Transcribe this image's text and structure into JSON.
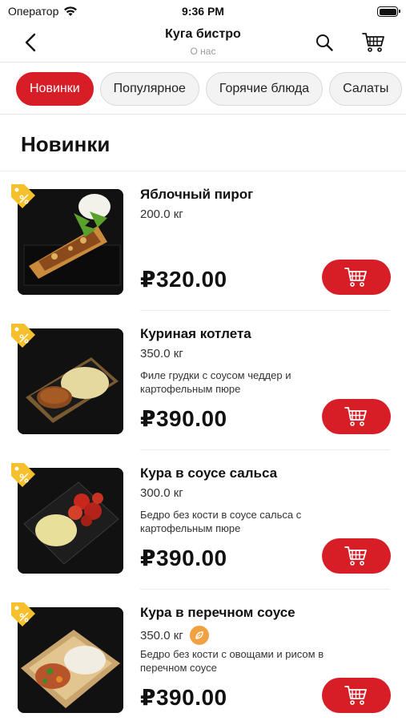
{
  "status_bar": {
    "carrier": "Оператор",
    "time": "9:36 PM"
  },
  "nav": {
    "title": "Куга бистро",
    "subtitle": "О нас"
  },
  "tabs": [
    {
      "label": "Новинки",
      "active": true
    },
    {
      "label": "Популярное",
      "active": false
    },
    {
      "label": "Горячие блюда",
      "active": false
    },
    {
      "label": "Салаты",
      "active": false
    }
  ],
  "section_title": "Новинки",
  "products": [
    {
      "name": "Яблочный пирог",
      "weight": "200.0 кг",
      "description": "",
      "price": "₽320.00"
    },
    {
      "name": "Куриная котлета",
      "weight": "350.0 кг",
      "description": "Филе грудки с соусом чеддер и картофельным пюре",
      "price": "₽390.00"
    },
    {
      "name": "Кура в соусе сальса",
      "weight": "300.0 кг",
      "description": "Бедро без кости в соусе сальса с картофельным пюре",
      "price": "₽390.00"
    },
    {
      "name": "Кура в перечном соусе",
      "weight": "350.0 кг",
      "description": "Бедро без кости с овощами и рисом в перечном соусе",
      "price": "₽390.00"
    }
  ],
  "colors": {
    "accent": "#d71d25",
    "badge": "#f5c02c",
    "extra_icon": "#f2a142"
  },
  "icons": {
    "back": "chevron-left-icon",
    "search": "search-icon",
    "cart": "cart-icon",
    "badge": "discount-tag-icon",
    "add": "add-to-cart-icon"
  }
}
